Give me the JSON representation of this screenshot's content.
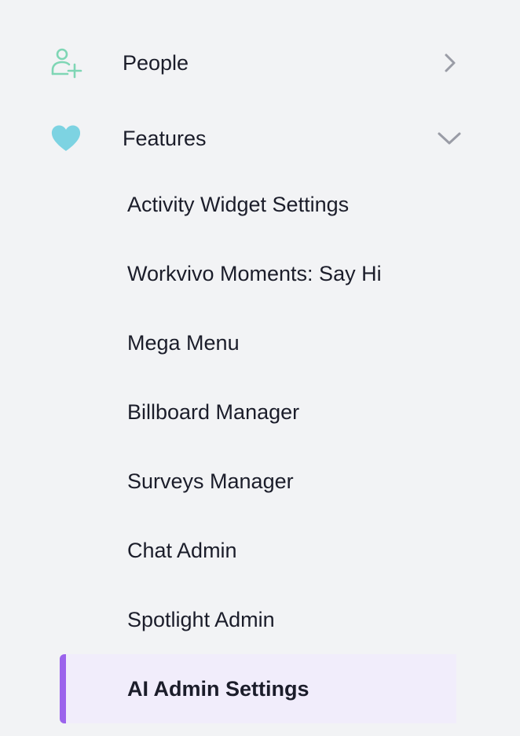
{
  "sidebar": {
    "sections": [
      {
        "label": "People",
        "icon": "add-person-icon",
        "icon_color": "#7fd6b5",
        "expanded": false,
        "chevron": "chevron-right-icon"
      },
      {
        "label": "Features",
        "icon": "heart-icon",
        "icon_color": "#7dd3e2",
        "expanded": true,
        "chevron": "chevron-down-icon"
      }
    ],
    "feature_items": [
      {
        "label": "Activity Widget Settings"
      },
      {
        "label": "Workvivo Moments: Say Hi"
      },
      {
        "label": "Mega Menu"
      },
      {
        "label": "Billboard Manager"
      },
      {
        "label": "Surveys Manager"
      },
      {
        "label": "Chat Admin"
      },
      {
        "label": "Spotlight Admin"
      },
      {
        "label": "AI Admin Settings",
        "active": true
      }
    ],
    "colors": {
      "background": "#f2f3f5",
      "text": "#1b1d2a",
      "chevron": "#9a9ca6",
      "active_background": "#f1edfb",
      "active_accent": "#9b63ec"
    }
  }
}
